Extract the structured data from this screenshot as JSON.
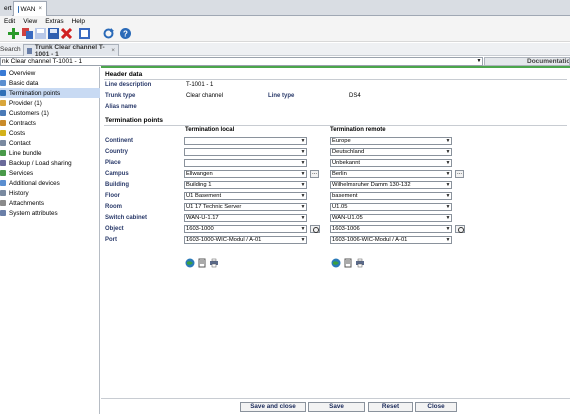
{
  "window_tabs": [
    {
      "label": "ert",
      "active": false
    },
    {
      "label": "WAN",
      "active": true,
      "close": "×"
    }
  ],
  "menu": [
    "Edit",
    "View",
    "Extras",
    "Help"
  ],
  "toolbar_icons": [
    "add-icon",
    "copy-icon",
    "save-icon",
    "save-all-icon",
    "delete-icon",
    "export-icon",
    "refresh-icon",
    "help-icon"
  ],
  "search_label": "Search",
  "doc_tab": {
    "label": "Trunk Clear channel T-1001 - 1",
    "close": "×"
  },
  "title_combo": "nk Clear channel T-1001 - 1",
  "documentation_button": "Documentation v",
  "sidebar": {
    "items": [
      {
        "label": "Overview",
        "icon": "overview-icon",
        "color": "#3a7bd5"
      },
      {
        "label": "Basic data",
        "icon": "basic-data-icon",
        "color": "#5b8fd0"
      },
      {
        "label": "Termination points",
        "icon": "termination-icon",
        "color": "#2f6fb7",
        "selected": true
      },
      {
        "label": "Provider (1)",
        "icon": "provider-icon",
        "color": "#d9a63a"
      },
      {
        "label": "Customers (1)",
        "icon": "customers-icon",
        "color": "#4a7ab7"
      },
      {
        "label": "Contracts",
        "icon": "contracts-icon",
        "color": "#c98b2b"
      },
      {
        "label": "Costs",
        "icon": "costs-icon",
        "color": "#d4b21a"
      },
      {
        "label": "Contact",
        "icon": "contact-icon",
        "color": "#7a8aa0"
      },
      {
        "label": "Line bundle",
        "icon": "line-bundle-icon",
        "color": "#4a9a4a"
      },
      {
        "label": "Backup / Load sharing",
        "icon": "backup-icon",
        "color": "#6a6a9a"
      },
      {
        "label": "Services",
        "icon": "services-icon",
        "color": "#4a9a4a"
      },
      {
        "label": "Additional devices",
        "icon": "devices-icon",
        "color": "#5b8fd0"
      },
      {
        "label": "History",
        "icon": "history-icon",
        "color": "#7a8aa0"
      },
      {
        "label": "Attachments",
        "icon": "attachments-icon",
        "color": "#8a8a8a"
      },
      {
        "label": "System attributes",
        "icon": "system-attributes-icon",
        "color": "#6a7fa8"
      }
    ]
  },
  "header": {
    "title": "Header data",
    "line_description_label": "Line description",
    "line_description": "T-1001 - 1",
    "trunk_type_label": "Trunk type",
    "trunk_type": "Clear channel",
    "line_type_label": "Line type",
    "line_type": "DS4",
    "alias_label": "Alias name"
  },
  "termination": {
    "title": "Termination points",
    "local_header": "Termination local",
    "remote_header": "Termination remote",
    "row_labels": [
      "Continent",
      "Country",
      "Place",
      "Campus",
      "Building",
      "Floor",
      "Room",
      "Switch cabinet",
      "Object",
      "Port"
    ],
    "local_values": [
      "",
      "",
      "",
      "Ellwangen",
      "Building 1",
      "U1 Basement",
      "U1 17 Technic Server",
      "WAN-U-1.17",
      "1603-1000",
      "1603-1000-WIC-Modul / A-01"
    ],
    "remote_values": [
      "Europe",
      "Deutschland",
      "Unbekannt",
      "Berlin",
      "Wilhelmsruher Damm 130-132",
      "basement",
      "U1.05",
      "WAN-U1.05",
      "1603-1006",
      "1603-1006-WIC-Modul / A-01"
    ]
  },
  "buttons": {
    "save_close": "Save and close",
    "save": "Save",
    "reset": "Reset",
    "close": "Close"
  }
}
